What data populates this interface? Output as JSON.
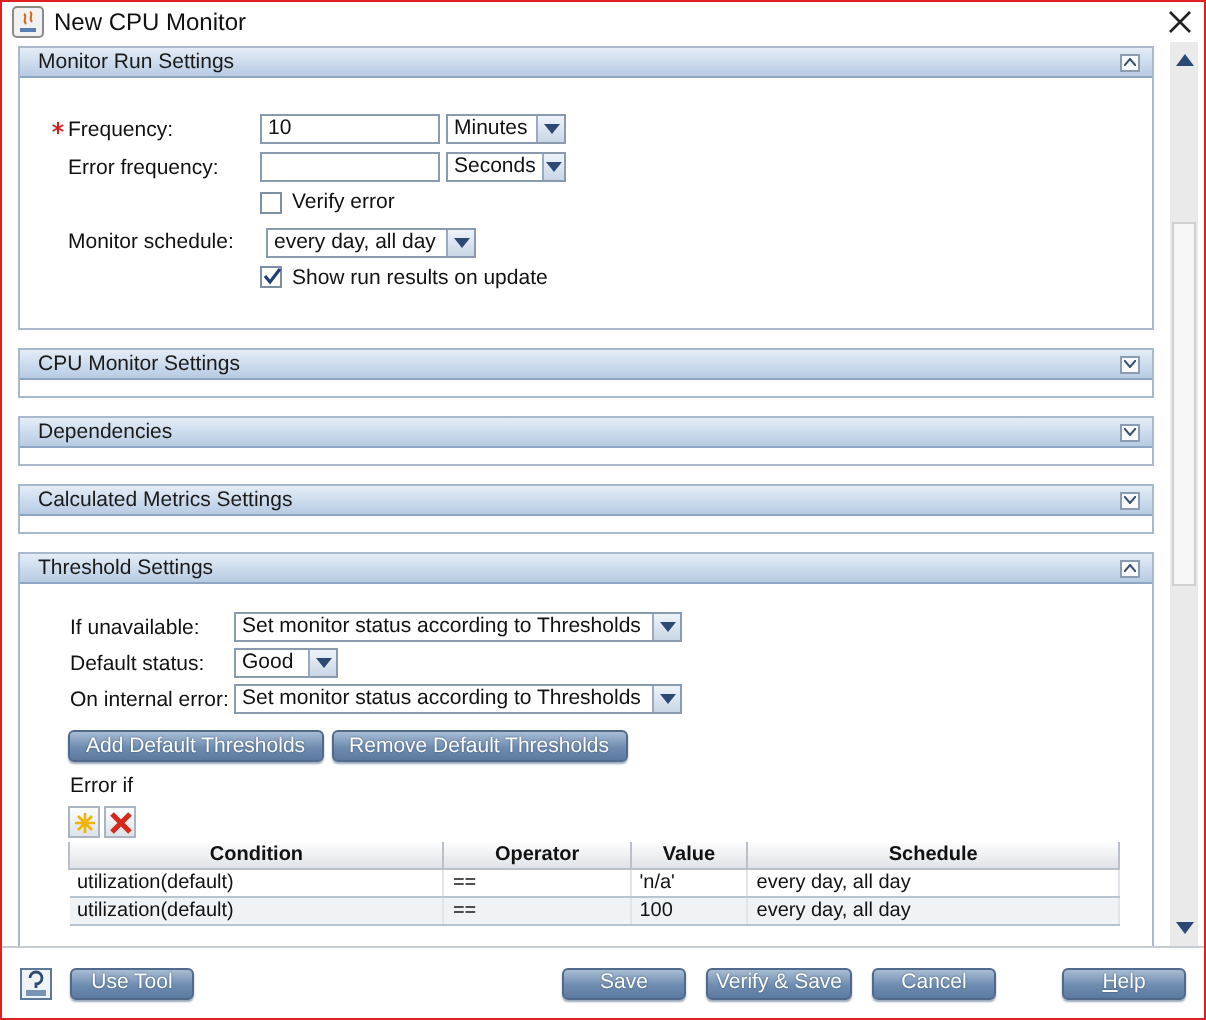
{
  "window": {
    "title": "New CPU Monitor"
  },
  "run_settings": {
    "title": "Monitor Run Settings",
    "expanded": true,
    "frequency": {
      "label": "Frequency:",
      "required": true,
      "value": "10",
      "unit": "Minutes"
    },
    "error_frequency": {
      "label": "Error frequency:",
      "required": false,
      "unit": "Seconds"
    },
    "verify_error": {
      "label": "Verify error",
      "checked": false
    },
    "monitor_schedule": {
      "label": "Monitor schedule:",
      "value": "every day, all day"
    },
    "show_run_results": {
      "label": "Show run results on update",
      "checked": true
    }
  },
  "collapsed_sections": [
    {
      "title": "CPU Monitor Settings",
      "expanded": false
    },
    {
      "title": "Dependencies",
      "expanded": false
    },
    {
      "title": "Calculated Metrics Settings",
      "expanded": false
    }
  ],
  "threshold_settings": {
    "title": "Threshold Settings",
    "expanded": true,
    "options": [
      {
        "label": "If unavailable:",
        "value": "Set monitor status according to Thresholds",
        "kind": "wide"
      },
      {
        "label": "Default status:",
        "value": "Good",
        "kind": "narrow"
      },
      {
        "label": "On internal error:",
        "value": "Set monitor status according to Thresholds",
        "kind": "wide"
      }
    ],
    "buttons": [
      "Add Default Thresholds",
      "Remove Default Thresholds"
    ],
    "error_if": "Error if",
    "table": {
      "columns": [
        "Condition",
        "Operator",
        "Value",
        "Schedule"
      ],
      "rows": [
        [
          "utilization(default)",
          "==",
          "'n/a'",
          "every day, all day"
        ],
        [
          "utilization(default)",
          "==",
          "100",
          "every day, all day"
        ]
      ]
    }
  },
  "footer_buttons": [
    {
      "label": "Use Tool",
      "kind": "left"
    },
    {
      "label": "Save",
      "kind": "right"
    },
    {
      "label": "Verify & Save",
      "kind": "right"
    },
    {
      "label": "Cancel",
      "kind": "right"
    },
    {
      "label": "Help",
      "kind": "far"
    }
  ]
}
